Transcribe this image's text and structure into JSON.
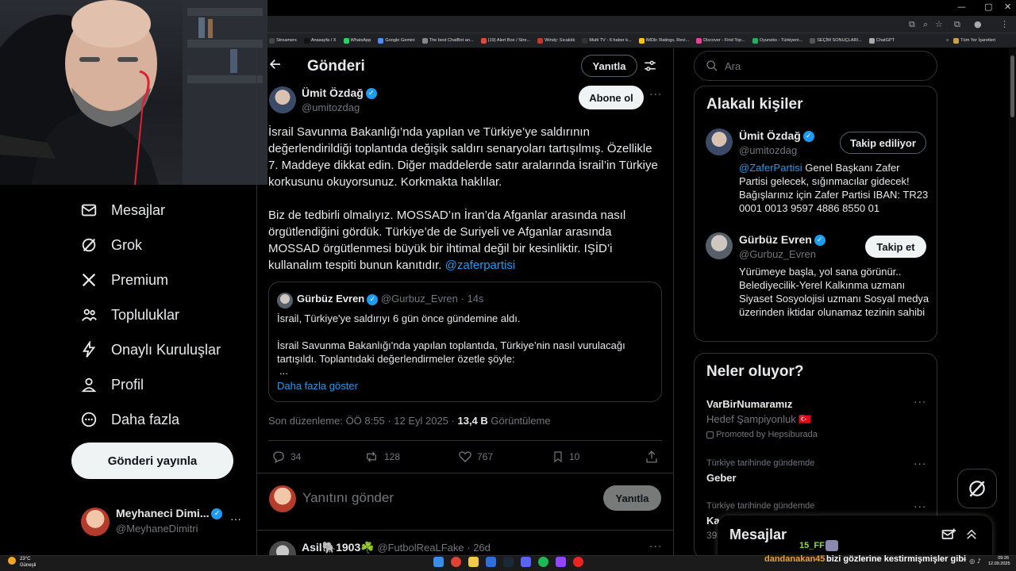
{
  "browser": {
    "window_controls": [
      "—",
      "▢",
      "✕"
    ],
    "bookmarks": [
      {
        "label": "Streamers",
        "color": "#444"
      },
      {
        "label": "Anasayfa / X",
        "color": "#111"
      },
      {
        "label": "WhatsApp",
        "color": "#25d366"
      },
      {
        "label": "Google Gemini",
        "color": "#4c8df6"
      },
      {
        "label": "The best ChatBot an...",
        "color": "#888"
      },
      {
        "label": "(19) Alert Box / Stre...",
        "color": "#e04a3f"
      },
      {
        "label": "Windy: Sıcaklık",
        "color": "#c0392b"
      },
      {
        "label": "Multi TV - 6 haber k...",
        "color": "#333"
      },
      {
        "label": "IMDb: Ratings, Revi...",
        "color": "#f5c518"
      },
      {
        "label": "Discover - Find Top...",
        "color": "#e84393"
      },
      {
        "label": "Oyuneks - Türkiyeni...",
        "color": "#27ae60"
      },
      {
        "label": "SEÇİM SONUÇLARI...",
        "color": "#555"
      },
      {
        "label": "ChatGPT",
        "color": "#aaa"
      }
    ],
    "bookmarks_more": "»",
    "bookmarks_all": "Tüm Yer İşaretleri"
  },
  "nav": {
    "items": [
      {
        "label": "Mesajlar",
        "icon": "mail-icon"
      },
      {
        "label": "Grok",
        "icon": "grok-icon"
      },
      {
        "label": "Premium",
        "icon": "x-icon"
      },
      {
        "label": "Topluluklar",
        "icon": "communities-icon"
      },
      {
        "label": "Onaylı Kuruluşlar",
        "icon": "lightning-icon"
      },
      {
        "label": "Profil",
        "icon": "profile-icon"
      },
      {
        "label": "Daha fazla",
        "icon": "more-icon"
      }
    ],
    "post_button": "Gönderi yayınla",
    "me": {
      "name": "Meyhaneci Dimi...",
      "handle": "@MeyhaneDimitri",
      "more": "···"
    }
  },
  "header": {
    "title": "Gönderi",
    "reply_button": "Yanıtla"
  },
  "post": {
    "author_name": "Ümit Özdağ",
    "author_handle": "@umitozdag",
    "subscribe_button": "Abone ol",
    "paragraph1": "İsrail Savunma Bakanlığı’nda yapılan ve Türkiye’ye saldırının değerlendirildiği toplantıda değişik saldırı senaryoları tartışılmış. Özellikle 7. Maddeye dikkat edin. Diğer maddelerde satır aralarında İsrail’in Türkiye korkusunu okuyorsunuz. Korkmakta haklılar.",
    "paragraph2": "Biz de tedbirli olmalıyız. MOSSAD’ın İran’da Afganlar arasında nasıl örgütlendiğini gördük. Türkiye’de de Suriyeli ve Afganlar arasında MOSSAD örgütlenmesi büyük bir ihtimal değil bir kesinliktir. IŞİD’i kullanalım tespiti bunun kanıtıdır.",
    "mention": "@zaferpartisi",
    "quote": {
      "author_name": "Gürbüz Evren",
      "author_handle": "@Gurbuz_Evren",
      "age": "· 14s",
      "line1": "İsrail, Türkiye'ye saldırıyı 6 gün önce gündemine aldı.",
      "line2": "İsrail Savunma Bakanlığı'nda yapılan toplantıda, Türkiye’nin nasıl vurulacağı tartışıldı. Toplantıdaki değerlendirmeler özetle şöyle:",
      "ellipsis": "...",
      "show_more": "Daha fazla göster"
    },
    "edited": "Son düzenleme: ÖÖ 8:55 · 12 Eyl 2025 ·",
    "views_count": "13,4 B",
    "views_label": "Görüntüleme",
    "stats": {
      "replies": "34",
      "reposts": "128",
      "likes": "767",
      "bookmarks": "10"
    }
  },
  "reply_box": {
    "placeholder": "Yanıtını gönder",
    "button": "Yanıtla"
  },
  "next_post": {
    "author_name": "Asil🐘1903☘️",
    "author_handle": "@FutbolReaLFake",
    "age": "· 26d"
  },
  "search": {
    "placeholder": "Ara"
  },
  "related": {
    "title": "Alakalı kişiler",
    "people": [
      {
        "name": "Ümit Özdağ",
        "handle": "@umitozdag",
        "button": "Takip ediliyor",
        "bio_mention": "@ZaferPartisi",
        "bio": " Genel Başkanı Zafer Partisi gelecek, sığınmacılar gidecek! Bağışlarınız için Zafer Partisi IBAN: TR23 0001 0013 9597 4886 8550 01"
      },
      {
        "name": "Gürbüz Evren",
        "handle": "@Gurbuz_Evren",
        "button": "Takip et",
        "bio": "Yürümeye başla, yol sana görünür.. Belediyecilik-Yerel Kalkınma uzmanı Siyaset Sosyolojisi uzmanı Sosyal medya üzerinden iktidar olunamaz tezinin sahibi"
      }
    ]
  },
  "trends": {
    "title": "Neler oluyor?",
    "items": [
      {
        "name": "VarBirNumaramız",
        "sub": "Hedef Şampiyonluk 🇹🇷",
        "promo": "Promoted by Hepsiburada"
      },
      {
        "context": "Türkiye tarihinde gündemde",
        "name": "Geber"
      },
      {
        "context": "Türkiye tarihinde gündemde",
        "name": "Ka"
      }
    ],
    "partial_count": "39,"
  },
  "messages_drawer": {
    "title": "Mesajlar"
  },
  "overlay_chat": {
    "user1": "15_FF",
    "user2": "dandanakan45",
    "message": "bizi gözlerine kestirmişmişler gibi"
  },
  "taskbar": {
    "weather_temp": "23°C",
    "weather_text": "Güneşli",
    "time": "09:26",
    "date": "12.09.2025"
  },
  "colors": {
    "accent": "#1d9bf0",
    "bg": "#000000",
    "border": "#2f3336",
    "muted": "#71767b"
  }
}
